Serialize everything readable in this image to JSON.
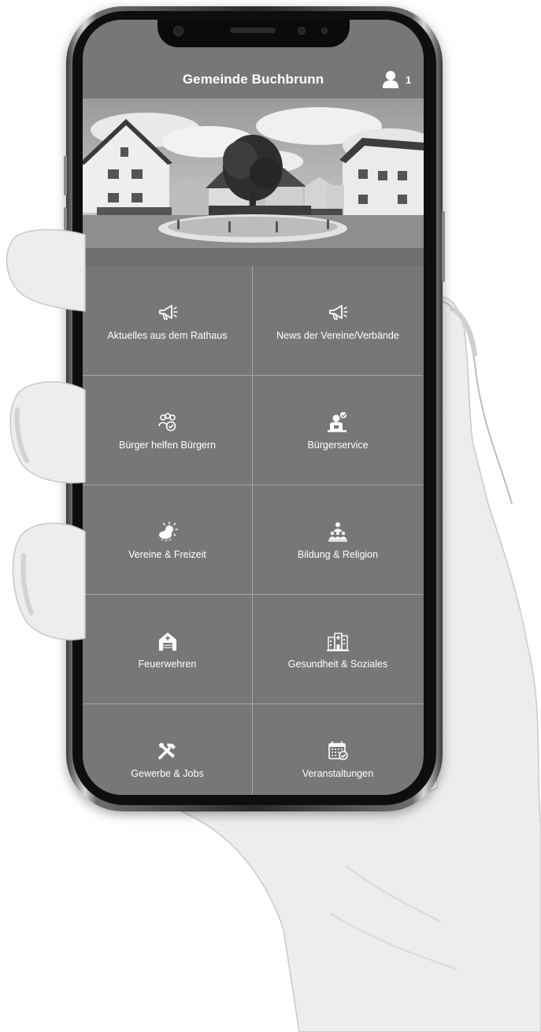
{
  "app": {
    "title": "Gemeinde Buchbrunn"
  },
  "header": {
    "profile_count": "1",
    "profile_icon": "user-icon"
  },
  "tiles": [
    {
      "label": "Aktuelles aus dem Rathaus",
      "icon": "megaphone-icon"
    },
    {
      "label": "News der Vereine/Verbände",
      "icon": "megaphone-icon"
    },
    {
      "label": "Bürger helfen Bürgern",
      "icon": "people-check-icon"
    },
    {
      "label": "Bürgerservice",
      "icon": "desk-service-icon"
    },
    {
      "label": "Vereine & Freizeit",
      "icon": "sun-cloud-icon"
    },
    {
      "label": "Bildung & Religion",
      "icon": "teacher-class-icon"
    },
    {
      "label": "Feuerwehren",
      "icon": "fire-station-icon"
    },
    {
      "label": "Gesundheit & Soziales",
      "icon": "hospital-icon"
    },
    {
      "label": "Gewerbe & Jobs",
      "icon": "tools-icon"
    },
    {
      "label": "Veranstaltungen",
      "icon": "calendar-check-icon"
    }
  ],
  "colors": {
    "screen_bg": "#777777",
    "divider": "#a6a6a6",
    "text": "#ffffff"
  }
}
